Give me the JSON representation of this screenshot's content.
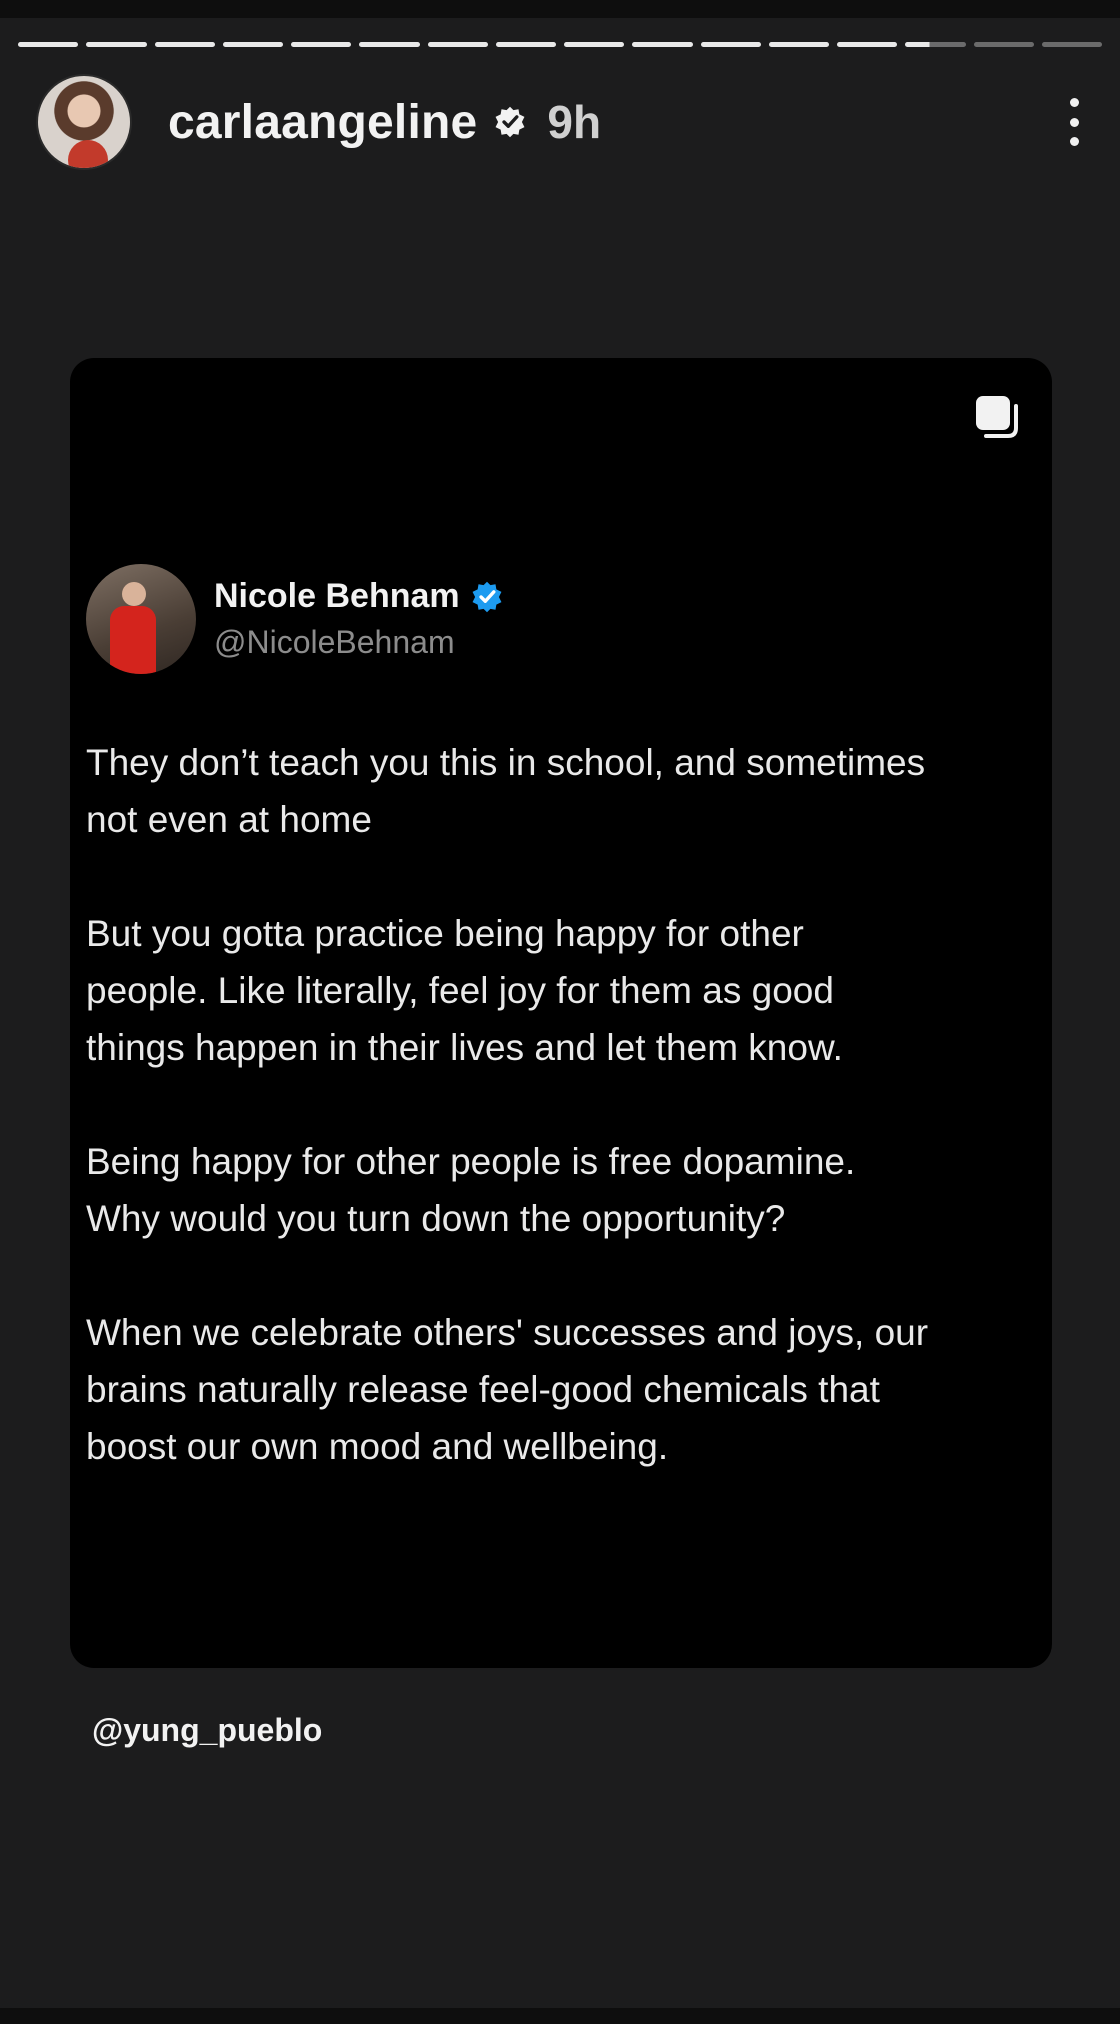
{
  "story": {
    "progress": {
      "segments": 16,
      "completed": 13,
      "current_fraction": 0.4
    },
    "header": {
      "username": "carlaangeline",
      "verified": true,
      "time": "9h"
    },
    "card": {
      "author_name": "Nicole Behnam",
      "author_handle": "@NicoleBehnam",
      "author_verified": true,
      "paragraphs": [
        "They don’t teach you this in school, and sometimes\nnot even at home",
        "But you gotta practice being happy for other\npeople. Like literally, feel joy for them as good\nthings happen in their lives and let them know.",
        "Being happy for other people is free dopamine.\nWhy would you turn down the opportunity?",
        "When we celebrate others' successes and joys, our\nbrains naturally release feel-good chemicals that\nboost our own mood and wellbeing."
      ]
    },
    "mention": "@yung_pueblo"
  },
  "colors": {
    "background": "#1c1c1d",
    "card": "#000000",
    "verified_blue": "#1d9bf0"
  },
  "icons": [
    "verified-badge-icon",
    "more-options-icon",
    "multiple-posts-icon"
  ]
}
